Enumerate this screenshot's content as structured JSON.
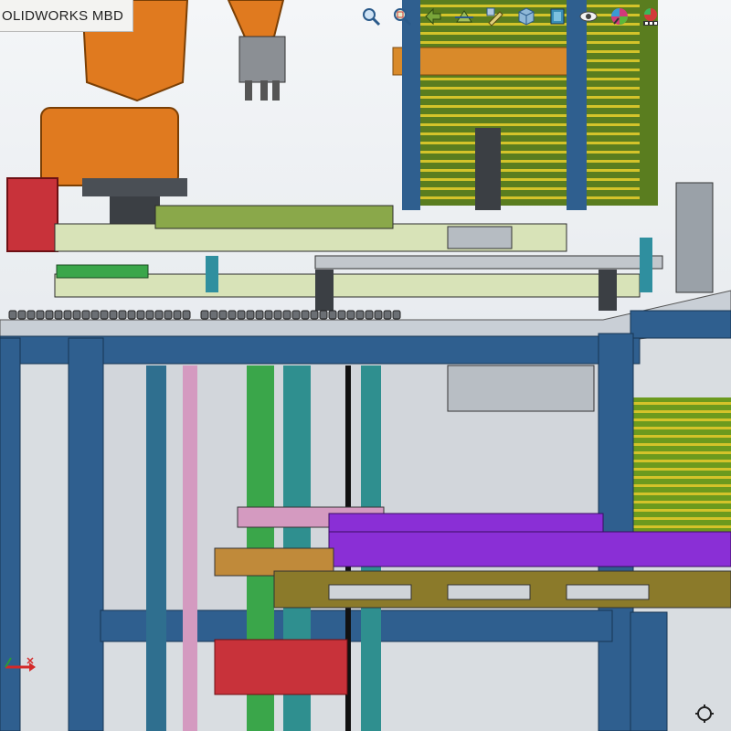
{
  "app": {
    "title": "OLIDWORKS MBD"
  },
  "hud_toolbar": {
    "buttons": [
      {
        "id": "zoom-to-fit",
        "icon": "magnifier-icon"
      },
      {
        "id": "zoom-to-area",
        "icon": "magnifier-area-icon"
      },
      {
        "id": "previous-view",
        "icon": "previous-view-icon"
      },
      {
        "id": "section-view",
        "icon": "section-view-icon"
      },
      {
        "id": "dynamic-annotation",
        "icon": "annotation-views-icon"
      },
      {
        "id": "view-orientation",
        "icon": "cube-orientation-icon"
      },
      {
        "id": "display-style",
        "icon": "display-style-cube-icon"
      },
      {
        "id": "hide-show-items",
        "icon": "eye-icon"
      },
      {
        "id": "edit-appearance",
        "icon": "appearance-sphere-icon"
      },
      {
        "id": "apply-scene",
        "icon": "scene-icon"
      }
    ]
  },
  "colors": {
    "frame_blue": "#2f5f8f",
    "table_top": "#c9cfd6",
    "rail_green": "#d8e3b8",
    "robot_orange": "#e07a1f",
    "tray_green": "#6c9a1e",
    "tray_yellow": "#d4c32a",
    "purple_carriage": "#8a2fd6",
    "pink_panel": "#d49ac0",
    "red_box": "#c8323a",
    "teal_post": "#2f8f8f"
  }
}
